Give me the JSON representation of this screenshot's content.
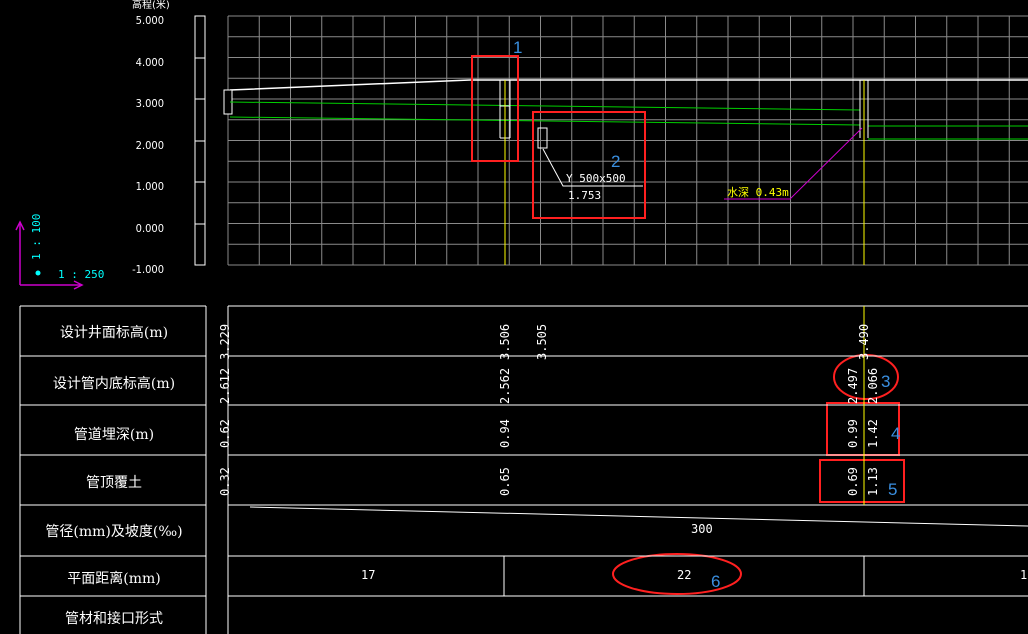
{
  "profile": {
    "axis_title": "高程(米)",
    "y_ticks": [
      "5.000",
      "4.000",
      "3.000",
      "2.000",
      "1.000",
      "0.000",
      "-1.000"
    ],
    "pipe_label": "Y 500x500",
    "pipe_value": "1.753",
    "water_label": "水深 0.43m",
    "vertical_scale": "1 : 100",
    "horizontal_scale": "1 : 250",
    "colors": {
      "grid": "#9a9a9a",
      "ground": "#ffffff",
      "pipe": "#00d000",
      "marker": "#ffff00",
      "leader": "#cc00cc",
      "highlight": "#ff2020",
      "annotation": "#3a8fe0"
    }
  },
  "table": {
    "rows": [
      {
        "label": "设计井面标高(m)",
        "values": [
          "3.229",
          "3.506",
          "3.505",
          "3.490"
        ]
      },
      {
        "label": "设计管内底标高(m)",
        "values": [
          "2.612",
          "2.562",
          "2.497",
          "2.066"
        ]
      },
      {
        "label": "管道埋深(m)",
        "values": [
          "0.62",
          "0.94",
          "0.99",
          "1.42"
        ]
      },
      {
        "label": "管顶覆土",
        "values": [
          "0.32",
          "0.65",
          "0.69",
          "1.13"
        ]
      },
      {
        "label": "管径(mm)及坡度(‰)",
        "values": [
          "300"
        ]
      },
      {
        "label": "平面距离(mm)",
        "values": [
          "17",
          "22",
          "1"
        ]
      },
      {
        "label": "管材和接口形式",
        "values": []
      }
    ]
  },
  "annotations": [
    "1",
    "2",
    "3",
    "4",
    "5",
    "6"
  ]
}
